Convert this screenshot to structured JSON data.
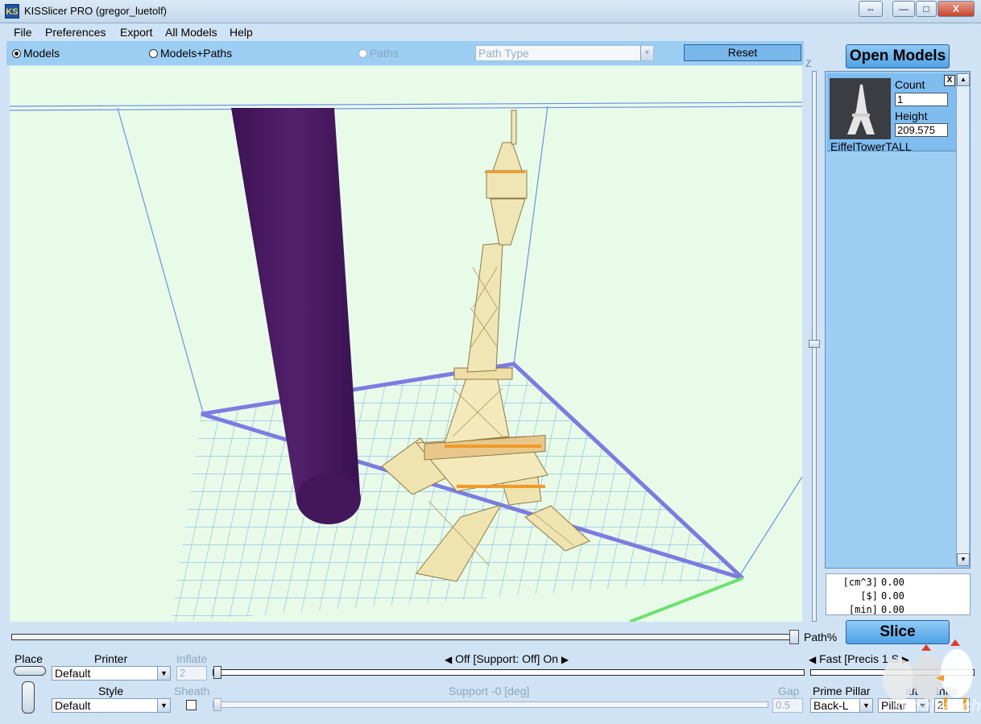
{
  "window": {
    "title": "KISSlicer PRO (gregor_luetolf)",
    "app_icon": "ks-icon",
    "buttons": {
      "restore": "⇔",
      "minimize": "—",
      "maximize": "□",
      "close": "X"
    }
  },
  "menu": [
    "File",
    "Preferences",
    "Export",
    "All Models",
    "Help"
  ],
  "view_options": {
    "models": "Models",
    "models_paths": "Models+Paths",
    "paths": "Paths",
    "selected": "models",
    "path_type_placeholder": "Path Type",
    "reset": "Reset"
  },
  "viewport": {
    "z_label": "Z",
    "path_label": "Path%",
    "colors": {
      "background": "#e8fbe8",
      "cylinder": "#4a1a63",
      "tower": "#f0e5b4",
      "bed_grid": "#6fa8e8",
      "bed_edge": "#7c7ce0",
      "x_axis": "#6ee06e"
    }
  },
  "models_panel": {
    "open_models": "Open Models",
    "model": {
      "name": "EiffelTowerTALL",
      "count_label": "Count",
      "count": "1",
      "height_label": "Height",
      "height": "209.575",
      "close": "X"
    }
  },
  "stats": [
    {
      "key": "[cm^3]",
      "value": "0.00"
    },
    {
      "key": "[$]",
      "value": "0.00"
    },
    {
      "key": "[min]",
      "value": "0.00"
    }
  ],
  "slice": "Slice",
  "bottom": {
    "place": "Place",
    "printer_label": "Printer",
    "printer_value": "Default",
    "inflate_label": "Inflate",
    "inflate_value": "2",
    "style_label": "Style",
    "style_value": "Default",
    "sheath_label": "Sheath",
    "support_toggle": "Off [Support: Off] On",
    "support_angle": "Support -0 [deg]",
    "gap_label": "Gap",
    "gap_value": "0.5",
    "speed": "Fast [Precis",
    "speed_value": "1",
    "speed_s": "S",
    "prime_pillar_label": "Prime Pillar",
    "prime_pillar_value": "Back-L",
    "raft_label": "aft",
    "raft_value": "Pillar",
    "inflate2_label": "Infla",
    "inflate2_value": "2"
  },
  "watermark": "schulkat.ch"
}
